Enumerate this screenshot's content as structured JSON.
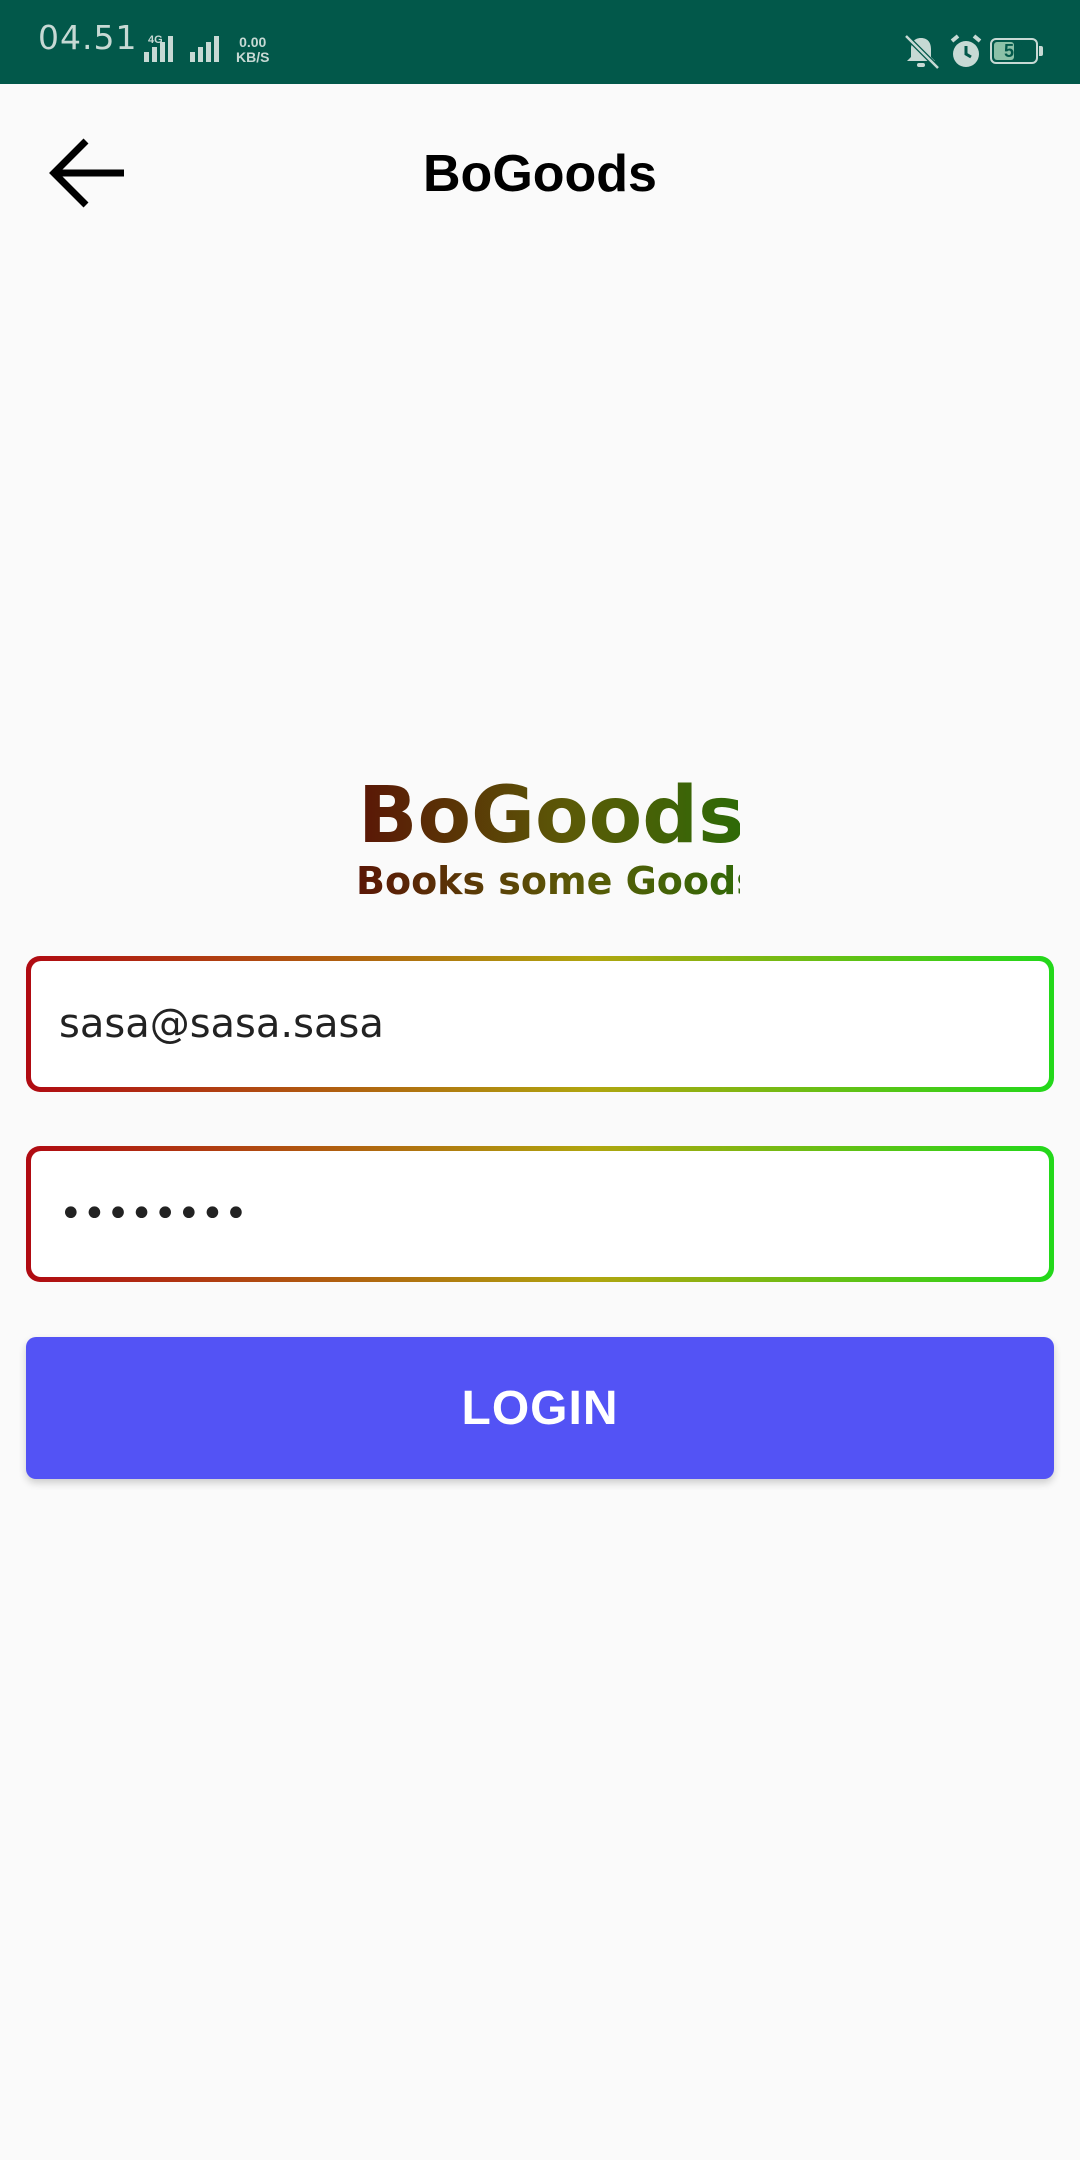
{
  "status_bar": {
    "time": "04.51",
    "network_type": "4G",
    "speed_value": "0.00",
    "speed_unit": "KB/S",
    "battery_level": "50",
    "icons": [
      "signal-icon",
      "signal-icon",
      "mute-icon",
      "alarm-icon",
      "battery-icon"
    ]
  },
  "app_bar": {
    "title": "BoGoods",
    "back_icon": "arrow-left-icon"
  },
  "logo": {
    "title": "BoGoods",
    "tagline": "Books some Goods",
    "gradient_colors": [
      "#5a1606",
      "#5b5a07",
      "#2d6a07"
    ]
  },
  "form": {
    "email_value": "sasa@sasa.sasa",
    "password_masked": "••••••••",
    "field_border_gradient": [
      "#b00a12",
      "#b0a50f",
      "#22d81a"
    ]
  },
  "login_button": {
    "label": "LOGIN",
    "color": "#5353f5"
  },
  "colors": {
    "status_bar": "#02584a",
    "background": "#fafafa"
  }
}
